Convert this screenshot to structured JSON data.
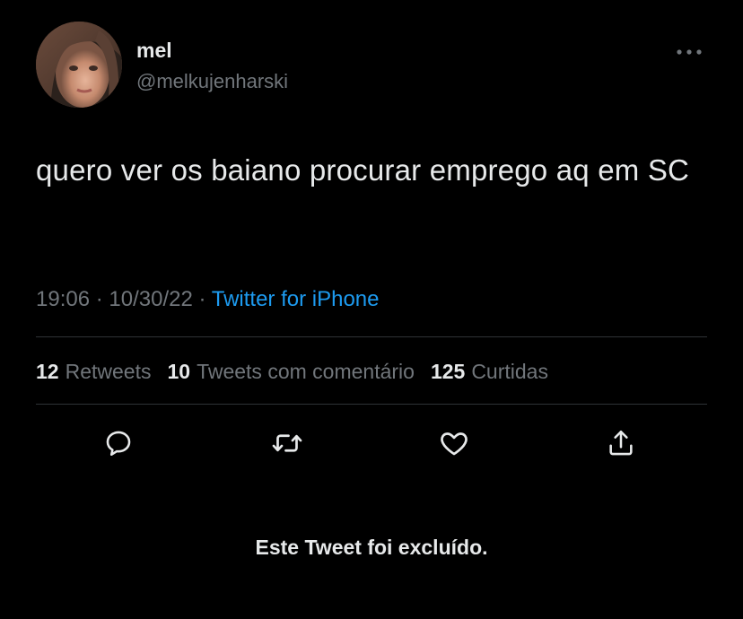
{
  "user": {
    "display_name": "mel",
    "handle": "@melkujenharski",
    "avatar": "profile-photo"
  },
  "more_icon": "more-horizontal-icon",
  "tweet": {
    "text": "quero ver os baiano procurar emprego aq em SC",
    "time": "19:06",
    "date": "10/30/22",
    "separator": "·",
    "source": "Twitter for iPhone"
  },
  "stats": {
    "retweets_count": "12",
    "retweets_label": "Retweets",
    "quotes_count": "10",
    "quotes_label": "Tweets com comentário",
    "likes_count": "125",
    "likes_label": "Curtidas"
  },
  "actions": {
    "reply_icon": "reply-icon",
    "retweet_icon": "retweet-icon",
    "like_icon": "heart-icon",
    "share_icon": "share-icon"
  },
  "deleted_notice": "Este Tweet foi excluído.",
  "colors": {
    "background": "#000000",
    "text": "#e7e9ea",
    "secondary": "#71767b",
    "link": "#1d9bf0",
    "divider": "#2f3336"
  }
}
